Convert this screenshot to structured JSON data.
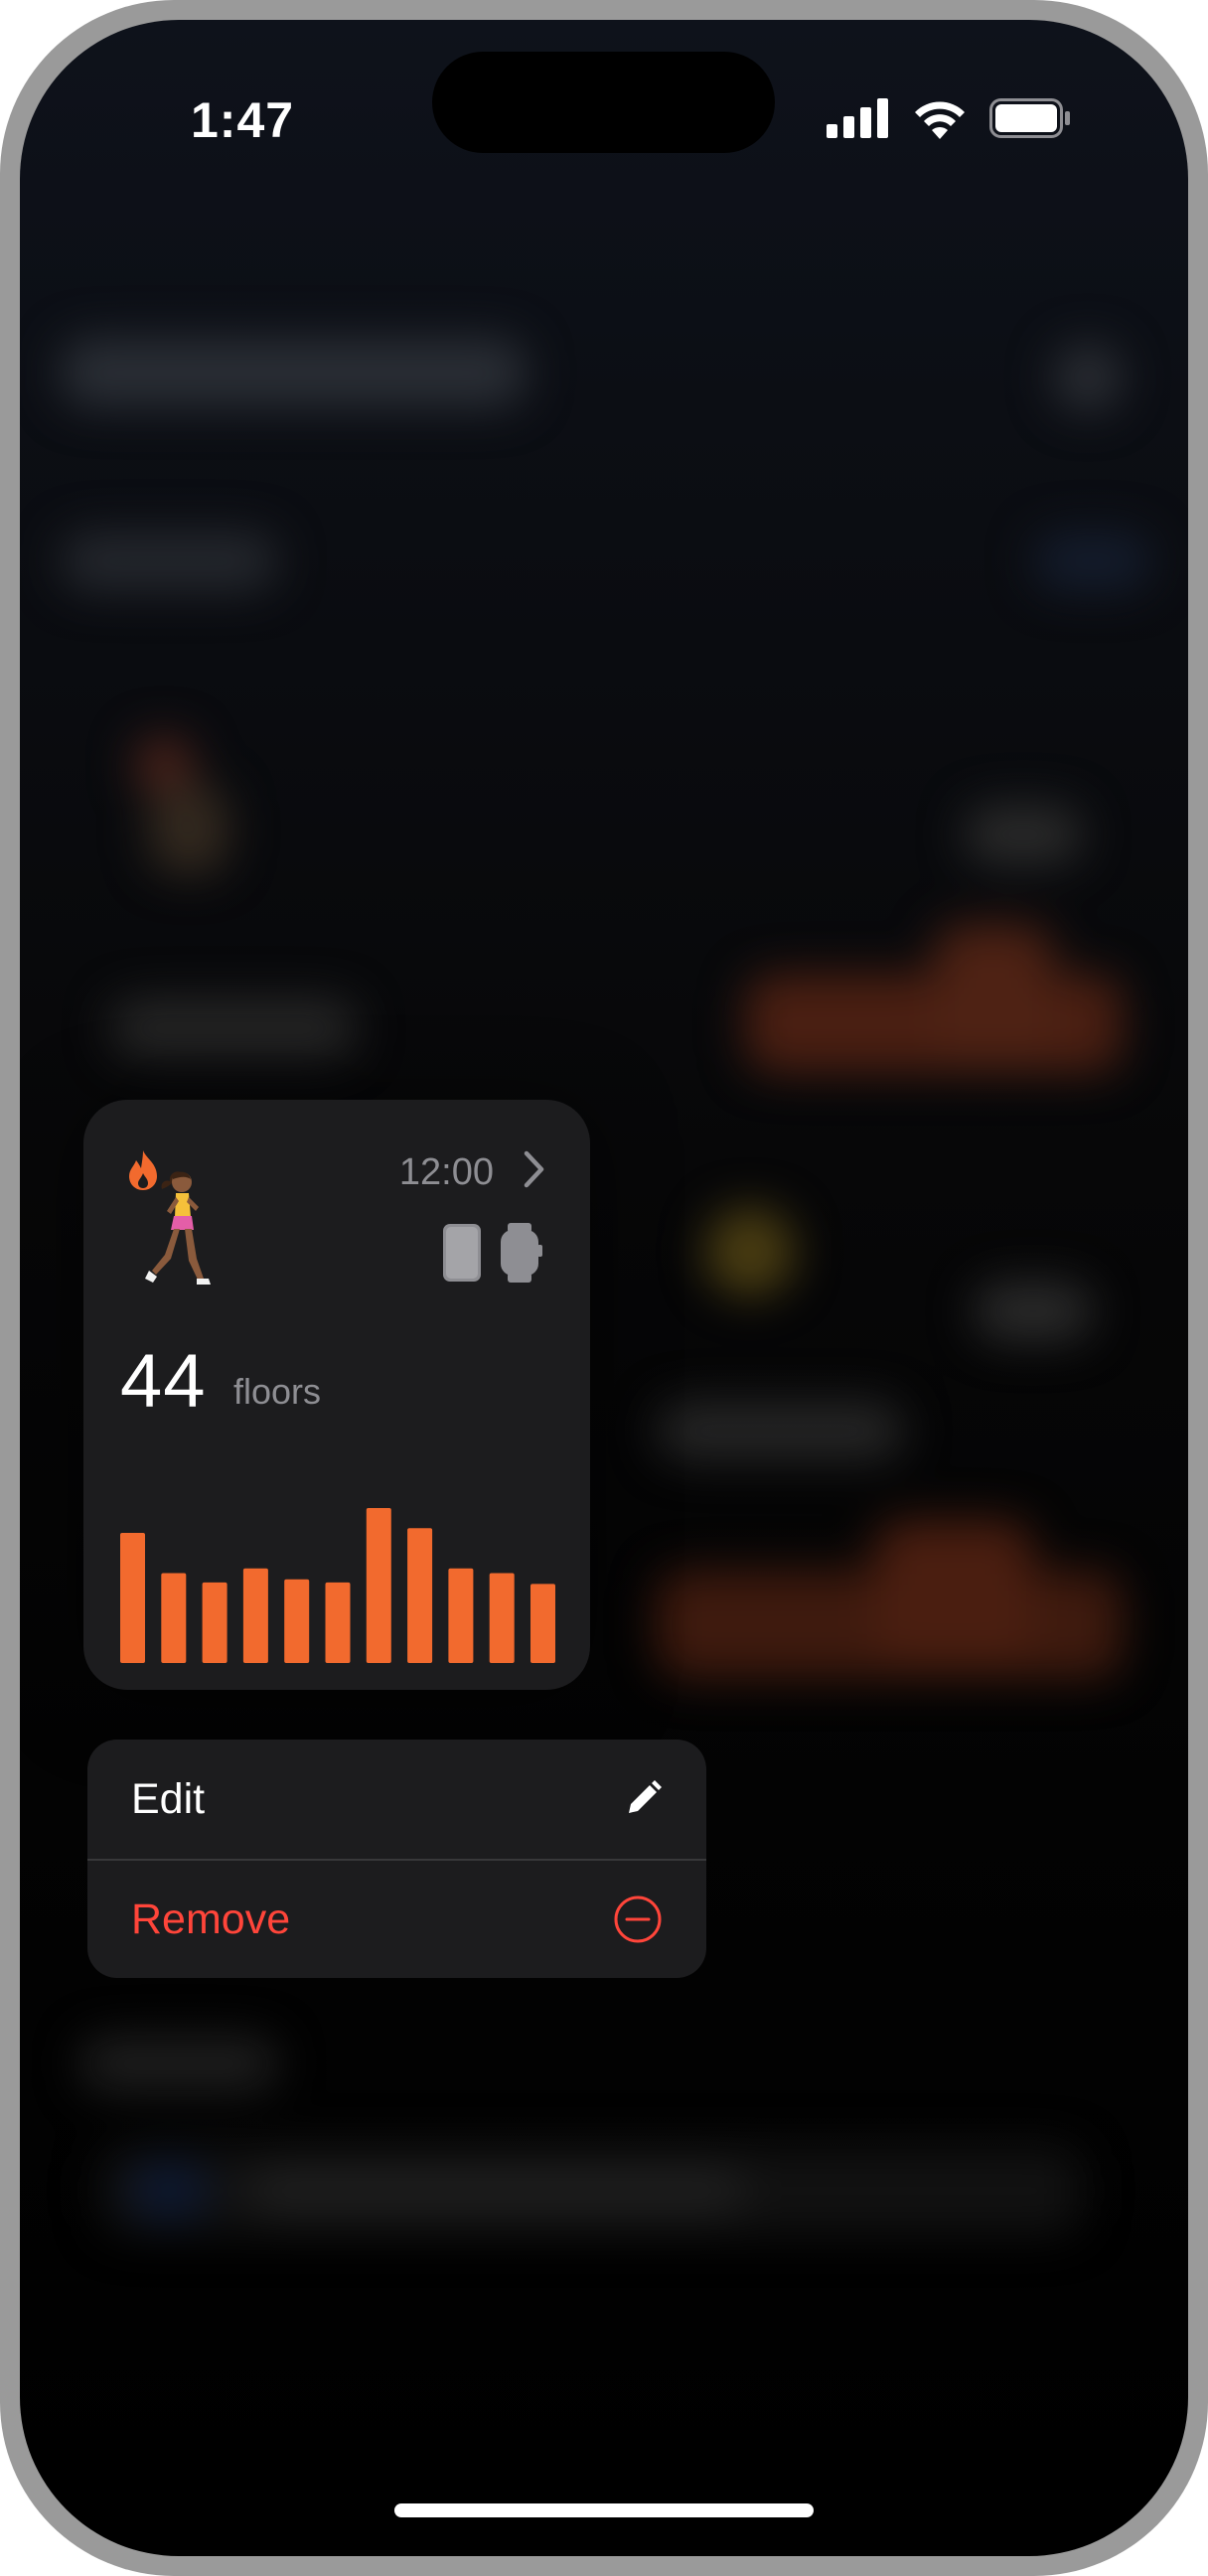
{
  "status_bar": {
    "time": "1:47",
    "icons": [
      "cellular-signal-icon",
      "wifi-icon",
      "battery-icon"
    ]
  },
  "widget": {
    "time": "12:00",
    "value": "44",
    "unit": "floors",
    "icons": [
      "flame-icon",
      "runner-emoji",
      "chevron-right-icon",
      "phone-icon",
      "watch-icon"
    ],
    "accent_color": "#f26a2e"
  },
  "chart_data": {
    "type": "bar",
    "series": [
      {
        "values": [
          0.84,
          0.58,
          0.52,
          0.61,
          0.54,
          0.52,
          1.0,
          0.87,
          0.61,
          0.58,
          0.51
        ]
      }
    ],
    "color": "#f26a2e"
  },
  "context_menu": {
    "items": [
      {
        "label": "Edit",
        "icon": "pencil-icon",
        "color": "#ffffff"
      },
      {
        "label": "Remove",
        "icon": "minus-circle-icon",
        "color": "#ff453a"
      }
    ]
  }
}
